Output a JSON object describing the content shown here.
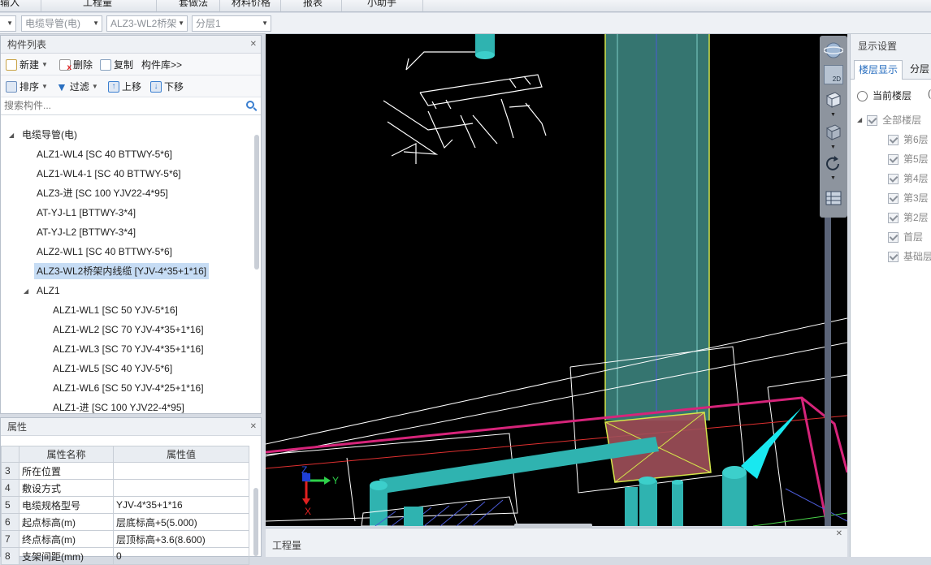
{
  "menubar": {
    "tabs": [
      "输入",
      "工程量",
      "套做法",
      "材料价格",
      "报表",
      "小助手"
    ]
  },
  "dropdowns": {
    "type_value": "电缆导管(电)",
    "component_value": "ALZ3-WL2桥架",
    "layer_value": "分层1"
  },
  "component_list": {
    "title": "构件列表",
    "new_label": "新建",
    "delete_label": "删除",
    "copy_label": "复制",
    "library_label": "构件库>>",
    "sort_label": "排序",
    "filter_label": "过滤",
    "up_label": "上移",
    "down_label": "下移",
    "search_placeholder": "搜索构件...",
    "tree": [
      {
        "label": "电缆导管(电)",
        "level": 0,
        "expanded": true
      },
      {
        "label": "ALZ1-WL4 [SC 40 BTTWY-5*6]",
        "level": 1
      },
      {
        "label": "ALZ1-WL4-1 [SC 40 BTTWY-5*6]",
        "level": 1
      },
      {
        "label": "ALZ3-进 [SC 100 YJV22-4*95]",
        "level": 1
      },
      {
        "label": "AT-YJ-L1 [BTTWY-3*4]",
        "level": 1
      },
      {
        "label": "AT-YJ-L2 [BTTWY-3*4]",
        "level": 1
      },
      {
        "label": "ALZ2-WL1 [SC 40 BTTWY-5*6]",
        "level": 1
      },
      {
        "label": "ALZ3-WL2桥架内线缆 [YJV-4*35+1*16]",
        "level": 1,
        "selected": true
      },
      {
        "label": "ALZ1",
        "level": 1,
        "expanded": true
      },
      {
        "label": "ALZ1-WL1 [SC 50 YJV-5*16]",
        "level": 2
      },
      {
        "label": "ALZ1-WL2 [SC 70 YJV-4*35+1*16]",
        "level": 2
      },
      {
        "label": "ALZ1-WL3 [SC 70 YJV-4*35+1*16]",
        "level": 2
      },
      {
        "label": "ALZ1-WL5 [SC 40 YJV-5*6]",
        "level": 2
      },
      {
        "label": "ALZ1-WL6 [SC 50 YJV-4*25+1*16]",
        "level": 2
      },
      {
        "label": "ALZ1-进 [SC 100 YJV22-4*95]",
        "level": 2
      }
    ]
  },
  "properties": {
    "title": "属性",
    "col_name": "属性名称",
    "col_value": "属性值",
    "rows": [
      {
        "num": "3",
        "name": "所在位置",
        "value": ""
      },
      {
        "num": "4",
        "name": "敷设方式",
        "value": ""
      },
      {
        "num": "5",
        "name": "电缆规格型号",
        "value": "YJV-4*35+1*16"
      },
      {
        "num": "6",
        "name": "起点标高(m)",
        "value": "层底标高+5(5.000)"
      },
      {
        "num": "7",
        "name": "终点标高(m)",
        "value": "层顶标高+3.6(8.600)"
      },
      {
        "num": "8",
        "name": "支架间距(mm)",
        "value": "0"
      }
    ]
  },
  "viewport": {
    "axis_labels": {
      "x": "X",
      "y": "Y",
      "z": "Z"
    },
    "view_2d_label": "2D"
  },
  "bottom_panel": {
    "title": "工程量"
  },
  "display_settings": {
    "title": "显示设置",
    "tab_floor": "楼层显示",
    "tab_layer": "分层",
    "radio_current": "当前楼层",
    "all_floors": "全部楼层",
    "floors": [
      "第6层",
      "第5层",
      "第4层",
      "第3层",
      "第2层",
      "首层",
      "基础层"
    ]
  },
  "colors": {
    "accent": "#2a6fc0",
    "selection": "#c6dcf4",
    "viewport_bg": "#000000",
    "pipe_teal": "#2fb3b0",
    "tray_magenta": "#d6247a"
  }
}
